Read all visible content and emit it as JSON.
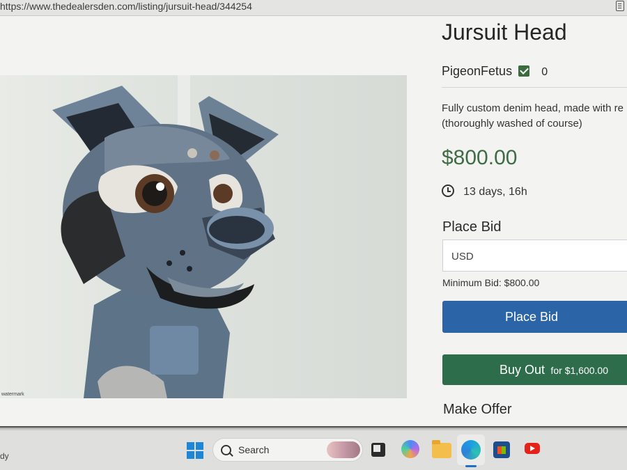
{
  "browser": {
    "url": "https://www.thedealersden.com/listing/jursuit-head/344254"
  },
  "listing": {
    "title": "Jursuit Head",
    "seller_name": "PigeonFetus",
    "seller_count": "0",
    "description_line1": "Fully custom denim head, made with re",
    "description_line2": "(thoroughly washed of course)",
    "price": "$800.00",
    "time_left": "13 days, 16h",
    "place_bid_heading": "Place Bid",
    "bid_currency": "USD",
    "minimum_bid": "Minimum Bid: $800.00",
    "place_bid_button": "Place Bid",
    "buyout_label": "Buy Out",
    "buyout_sub": "for $1,600.00",
    "make_offer_heading": "Make Offer",
    "colors": {
      "price": "#3f6b45",
      "place_bid_button": "#2c64a8",
      "buyout_button": "#2e6d4b",
      "verified_badge": "#3b6b3e"
    }
  },
  "taskbar": {
    "left_text": "dy",
    "search_text": "Search",
    "icons": [
      "windows-start-icon",
      "search-icon",
      "task-view-icon",
      "copilot-icon",
      "file-explorer-icon",
      "edge-icon",
      "microsoft-store-icon",
      "youtube-icon"
    ]
  }
}
